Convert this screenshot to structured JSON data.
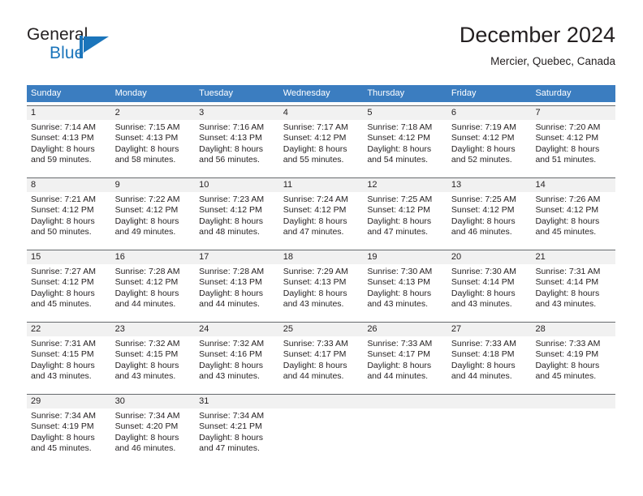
{
  "brand": {
    "name_part1": "General",
    "name_part2": "Blue",
    "mark_icon": "triangle-logo-icon",
    "accent_color": "#1b75bb"
  },
  "header": {
    "title": "December 2024",
    "subtitle": "Mercier, Quebec, Canada"
  },
  "calendar": {
    "header_color": "#3b7dc0",
    "daynum_bg": "#f1f1f1",
    "weekday_names": [
      "Sunday",
      "Monday",
      "Tuesday",
      "Wednesday",
      "Thursday",
      "Friday",
      "Saturday"
    ],
    "weeks": [
      [
        {
          "day": "1",
          "l1": "Sunrise: 7:14 AM",
          "l2": "Sunset: 4:13 PM",
          "l3": "Daylight: 8 hours",
          "l4": "and 59 minutes."
        },
        {
          "day": "2",
          "l1": "Sunrise: 7:15 AM",
          "l2": "Sunset: 4:13 PM",
          "l3": "Daylight: 8 hours",
          "l4": "and 58 minutes."
        },
        {
          "day": "3",
          "l1": "Sunrise: 7:16 AM",
          "l2": "Sunset: 4:13 PM",
          "l3": "Daylight: 8 hours",
          "l4": "and 56 minutes."
        },
        {
          "day": "4",
          "l1": "Sunrise: 7:17 AM",
          "l2": "Sunset: 4:12 PM",
          "l3": "Daylight: 8 hours",
          "l4": "and 55 minutes."
        },
        {
          "day": "5",
          "l1": "Sunrise: 7:18 AM",
          "l2": "Sunset: 4:12 PM",
          "l3": "Daylight: 8 hours",
          "l4": "and 54 minutes."
        },
        {
          "day": "6",
          "l1": "Sunrise: 7:19 AM",
          "l2": "Sunset: 4:12 PM",
          "l3": "Daylight: 8 hours",
          "l4": "and 52 minutes."
        },
        {
          "day": "7",
          "l1": "Sunrise: 7:20 AM",
          "l2": "Sunset: 4:12 PM",
          "l3": "Daylight: 8 hours",
          "l4": "and 51 minutes."
        }
      ],
      [
        {
          "day": "8",
          "l1": "Sunrise: 7:21 AM",
          "l2": "Sunset: 4:12 PM",
          "l3": "Daylight: 8 hours",
          "l4": "and 50 minutes."
        },
        {
          "day": "9",
          "l1": "Sunrise: 7:22 AM",
          "l2": "Sunset: 4:12 PM",
          "l3": "Daylight: 8 hours",
          "l4": "and 49 minutes."
        },
        {
          "day": "10",
          "l1": "Sunrise: 7:23 AM",
          "l2": "Sunset: 4:12 PM",
          "l3": "Daylight: 8 hours",
          "l4": "and 48 minutes."
        },
        {
          "day": "11",
          "l1": "Sunrise: 7:24 AM",
          "l2": "Sunset: 4:12 PM",
          "l3": "Daylight: 8 hours",
          "l4": "and 47 minutes."
        },
        {
          "day": "12",
          "l1": "Sunrise: 7:25 AM",
          "l2": "Sunset: 4:12 PM",
          "l3": "Daylight: 8 hours",
          "l4": "and 47 minutes."
        },
        {
          "day": "13",
          "l1": "Sunrise: 7:25 AM",
          "l2": "Sunset: 4:12 PM",
          "l3": "Daylight: 8 hours",
          "l4": "and 46 minutes."
        },
        {
          "day": "14",
          "l1": "Sunrise: 7:26 AM",
          "l2": "Sunset: 4:12 PM",
          "l3": "Daylight: 8 hours",
          "l4": "and 45 minutes."
        }
      ],
      [
        {
          "day": "15",
          "l1": "Sunrise: 7:27 AM",
          "l2": "Sunset: 4:12 PM",
          "l3": "Daylight: 8 hours",
          "l4": "and 45 minutes."
        },
        {
          "day": "16",
          "l1": "Sunrise: 7:28 AM",
          "l2": "Sunset: 4:12 PM",
          "l3": "Daylight: 8 hours",
          "l4": "and 44 minutes."
        },
        {
          "day": "17",
          "l1": "Sunrise: 7:28 AM",
          "l2": "Sunset: 4:13 PM",
          "l3": "Daylight: 8 hours",
          "l4": "and 44 minutes."
        },
        {
          "day": "18",
          "l1": "Sunrise: 7:29 AM",
          "l2": "Sunset: 4:13 PM",
          "l3": "Daylight: 8 hours",
          "l4": "and 43 minutes."
        },
        {
          "day": "19",
          "l1": "Sunrise: 7:30 AM",
          "l2": "Sunset: 4:13 PM",
          "l3": "Daylight: 8 hours",
          "l4": "and 43 minutes."
        },
        {
          "day": "20",
          "l1": "Sunrise: 7:30 AM",
          "l2": "Sunset: 4:14 PM",
          "l3": "Daylight: 8 hours",
          "l4": "and 43 minutes."
        },
        {
          "day": "21",
          "l1": "Sunrise: 7:31 AM",
          "l2": "Sunset: 4:14 PM",
          "l3": "Daylight: 8 hours",
          "l4": "and 43 minutes."
        }
      ],
      [
        {
          "day": "22",
          "l1": "Sunrise: 7:31 AM",
          "l2": "Sunset: 4:15 PM",
          "l3": "Daylight: 8 hours",
          "l4": "and 43 minutes."
        },
        {
          "day": "23",
          "l1": "Sunrise: 7:32 AM",
          "l2": "Sunset: 4:15 PM",
          "l3": "Daylight: 8 hours",
          "l4": "and 43 minutes."
        },
        {
          "day": "24",
          "l1": "Sunrise: 7:32 AM",
          "l2": "Sunset: 4:16 PM",
          "l3": "Daylight: 8 hours",
          "l4": "and 43 minutes."
        },
        {
          "day": "25",
          "l1": "Sunrise: 7:33 AM",
          "l2": "Sunset: 4:17 PM",
          "l3": "Daylight: 8 hours",
          "l4": "and 44 minutes."
        },
        {
          "day": "26",
          "l1": "Sunrise: 7:33 AM",
          "l2": "Sunset: 4:17 PM",
          "l3": "Daylight: 8 hours",
          "l4": "and 44 minutes."
        },
        {
          "day": "27",
          "l1": "Sunrise: 7:33 AM",
          "l2": "Sunset: 4:18 PM",
          "l3": "Daylight: 8 hours",
          "l4": "and 44 minutes."
        },
        {
          "day": "28",
          "l1": "Sunrise: 7:33 AM",
          "l2": "Sunset: 4:19 PM",
          "l3": "Daylight: 8 hours",
          "l4": "and 45 minutes."
        }
      ],
      [
        {
          "day": "29",
          "l1": "Sunrise: 7:34 AM",
          "l2": "Sunset: 4:19 PM",
          "l3": "Daylight: 8 hours",
          "l4": "and 45 minutes."
        },
        {
          "day": "30",
          "l1": "Sunrise: 7:34 AM",
          "l2": "Sunset: 4:20 PM",
          "l3": "Daylight: 8 hours",
          "l4": "and 46 minutes."
        },
        {
          "day": "31",
          "l1": "Sunrise: 7:34 AM",
          "l2": "Sunset: 4:21 PM",
          "l3": "Daylight: 8 hours",
          "l4": "and 47 minutes."
        },
        {
          "day": "",
          "l1": "",
          "l2": "",
          "l3": "",
          "l4": ""
        },
        {
          "day": "",
          "l1": "",
          "l2": "",
          "l3": "",
          "l4": ""
        },
        {
          "day": "",
          "l1": "",
          "l2": "",
          "l3": "",
          "l4": ""
        },
        {
          "day": "",
          "l1": "",
          "l2": "",
          "l3": "",
          "l4": ""
        }
      ]
    ]
  }
}
